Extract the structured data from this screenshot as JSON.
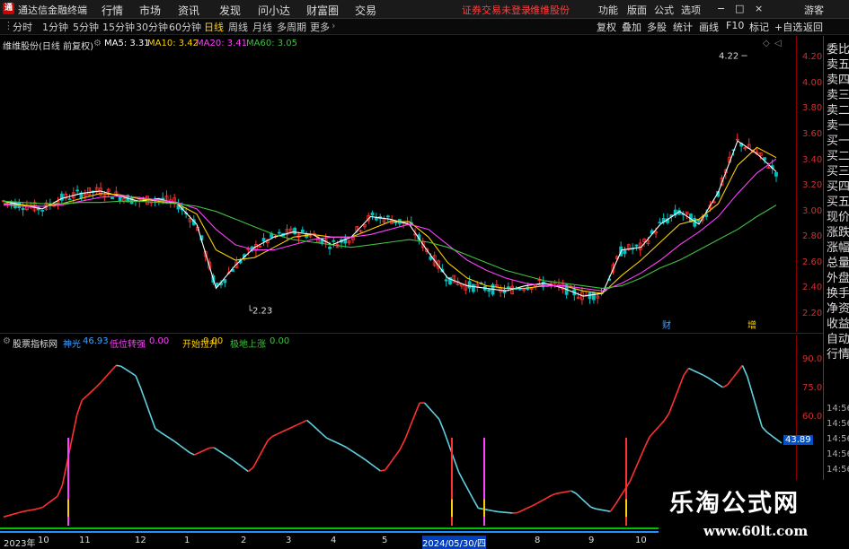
{
  "topbar": {
    "logo": "通",
    "app_title": "通达信金融终端",
    "menus": [
      "行情",
      "市场",
      "资讯",
      "发现",
      "问小达",
      "财富圈",
      "交易"
    ],
    "warning": "证券交易未登录",
    "stock_link": "维维股份",
    "right_menus": [
      "功能",
      "版面",
      "公式",
      "选项"
    ],
    "guest": "游客",
    "win_controls": [
      "−",
      "□",
      "×"
    ]
  },
  "tabbar": {
    "tabs": [
      "分时",
      "1分钟",
      "5分钟",
      "15分钟",
      "30分钟",
      "60分钟",
      "日线",
      "周线",
      "月线",
      "多周期",
      "更多"
    ],
    "active": "日线",
    "right_tabs": [
      "复权",
      "叠加",
      "多股",
      "统计",
      "画线",
      "F10",
      "标记",
      "+自选",
      "返回"
    ]
  },
  "main_chart": {
    "title": "维维股份(日线 前复权)",
    "ma5": "MA5: 3.31",
    "ma10": "MA10: 3.42",
    "ma20": "MA20: 3.41",
    "ma60": "MA60: 3.05",
    "y_ticks": [
      "4.20",
      "4.00",
      "3.80",
      "3.60",
      "3.40",
      "3.20",
      "3.00",
      "2.80",
      "2.60",
      "2.40",
      "2.20"
    ],
    "high_label": "4.22",
    "low_label": "2.23",
    "markers": [
      "财",
      "增"
    ],
    "colors": {
      "ma5": "#ffffff",
      "ma10": "#ffd000",
      "ma20": "#ff40ff",
      "ma60": "#40c040",
      "up": "#ff3030",
      "down": "#00c0c0",
      "axis": "#d03030"
    }
  },
  "chart_data": [
    {
      "type": "line",
      "title": "维维股份(日线 前复权)",
      "ylim": [
        2.2,
        4.3
      ],
      "series": [
        {
          "name": "MA5",
          "values": [
            3.08,
            3.05,
            3.02,
            3.1,
            3.14,
            3.16,
            3.12,
            3.08,
            3.1,
            3.06,
            2.9,
            2.4,
            2.58,
            2.72,
            2.8,
            2.84,
            2.82,
            2.74,
            2.8,
            2.96,
            2.94,
            2.9,
            2.68,
            2.48,
            2.42,
            2.4,
            2.38,
            2.42,
            2.44,
            2.4,
            2.34,
            2.36,
            2.7,
            2.72,
            2.9,
            3.0,
            2.9,
            3.15,
            3.55,
            3.45,
            3.31
          ]
        },
        {
          "name": "MA10",
          "values": [
            3.06,
            3.05,
            3.04,
            3.06,
            3.1,
            3.14,
            3.13,
            3.1,
            3.08,
            3.06,
            2.98,
            2.7,
            2.62,
            2.64,
            2.72,
            2.8,
            2.82,
            2.8,
            2.8,
            2.86,
            2.92,
            2.92,
            2.8,
            2.6,
            2.48,
            2.42,
            2.4,
            2.4,
            2.42,
            2.42,
            2.38,
            2.36,
            2.5,
            2.62,
            2.76,
            2.9,
            2.94,
            3.06,
            3.36,
            3.5,
            3.42
          ]
        },
        {
          "name": "MA20",
          "values": [
            3.05,
            3.04,
            3.04,
            3.05,
            3.08,
            3.11,
            3.12,
            3.11,
            3.09,
            3.07,
            3.02,
            2.86,
            2.74,
            2.7,
            2.7,
            2.74,
            2.78,
            2.8,
            2.8,
            2.82,
            2.86,
            2.9,
            2.86,
            2.74,
            2.62,
            2.54,
            2.48,
            2.44,
            2.42,
            2.42,
            2.4,
            2.38,
            2.44,
            2.52,
            2.62,
            2.74,
            2.84,
            2.96,
            3.14,
            3.3,
            3.41
          ]
        },
        {
          "name": "MA60",
          "values": [
            3.08,
            3.07,
            3.06,
            3.06,
            3.07,
            3.07,
            3.08,
            3.08,
            3.07,
            3.06,
            3.04,
            3.0,
            2.94,
            2.88,
            2.82,
            2.78,
            2.76,
            2.74,
            2.72,
            2.74,
            2.76,
            2.78,
            2.76,
            2.72,
            2.66,
            2.6,
            2.54,
            2.5,
            2.46,
            2.44,
            2.42,
            2.4,
            2.42,
            2.48,
            2.56,
            2.62,
            2.7,
            2.78,
            2.86,
            2.96,
            3.05
          ]
        }
      ]
    },
    {
      "type": "line",
      "title": "股票指标网",
      "ylim": [
        0,
        100
      ],
      "series": [
        {
          "name": "神光",
          "values": [
            5,
            8,
            10,
            18,
            70,
            80,
            92,
            85,
            55,
            48,
            40,
            45,
            38,
            30,
            50,
            55,
            60,
            50,
            45,
            38,
            30,
            45,
            72,
            60,
            30,
            10,
            8,
            7,
            12,
            18,
            20,
            10,
            8,
            25,
            50,
            62,
            90,
            85,
            78,
            92,
            55,
            46.93
          ]
        }
      ]
    }
  ],
  "indicator": {
    "name": "股票指标网",
    "shenguang": "神光",
    "shenguang_val": "46.93",
    "diwei": "低位转强",
    "diwei_val": "0.00",
    "kaishi": "开始拉升",
    "kaishi_val": "0.00",
    "jidi": "极地上涨",
    "jidi_val": "0.00",
    "y_ticks": [
      "90.00",
      "75.00",
      "60.00"
    ],
    "current_val": "43.89"
  },
  "right_panel": {
    "labels": [
      "委比",
      "卖五",
      "卖四",
      "卖三",
      "卖二",
      "卖一",
      "买一",
      "买二",
      "买三",
      "买四",
      "买五",
      "现价",
      "涨跌",
      "涨幅",
      "总量",
      "外盘",
      "换手",
      "净资",
      "收益",
      "自动",
      "行情"
    ],
    "times": [
      "14:56",
      "14:56",
      "14:56",
      "14:56",
      "14:56",
      "14:56",
      "14:56"
    ]
  },
  "datebar": {
    "labels": [
      "2023年",
      "10",
      "11",
      "12",
      "1",
      "2",
      "3",
      "4",
      "5",
      "2024/05/30/四",
      "8",
      "9",
      "10"
    ]
  },
  "watermark": {
    "cn": "乐淘公式网",
    "url": "www.60lt.com"
  }
}
